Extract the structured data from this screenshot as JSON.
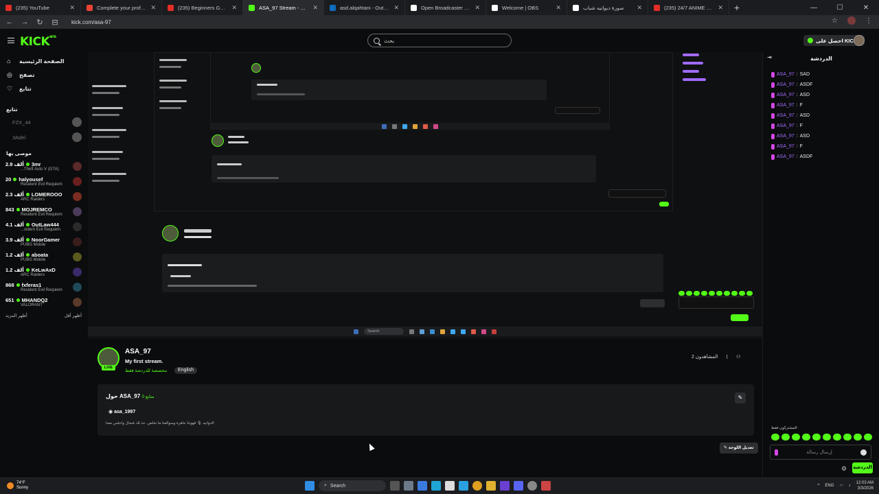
{
  "browser": {
    "tabs": [
      {
        "label": "(235) YouTube",
        "color": "#e52d27",
        "active": false
      },
      {
        "label": "Complete your profile - dr.ahm",
        "color": "#ea4335",
        "active": false
      },
      {
        "label": "(235) Beginners Guide to Kick S",
        "color": "#e52d27",
        "active": false
      },
      {
        "label": "ASA_97 Stream - Watch Live on",
        "color": "#53fc18",
        "active": true
      },
      {
        "label": "asd.alqahtani - Outlook - البريد",
        "color": "#0f6cbd",
        "active": false
      },
      {
        "label": "Open Broadcaster Software | O",
        "color": "#ffffff",
        "active": false
      },
      {
        "label": "Welcome | OBS",
        "color": "#ffffff",
        "active": false
      },
      {
        "label": "صورة ديوانيه شباب",
        "color": "#ffffff",
        "active": false
      },
      {
        "label": "(235) 24/7 ANIME LOFI & CHIL",
        "color": "#e52d27",
        "active": false
      }
    ],
    "url": "kick.com/asa-97"
  },
  "header": {
    "logo": "KICK",
    "logo_sup": "BETA",
    "search_placeholder": "بحث",
    "get_kicks": "احصل على KICKs"
  },
  "sidebar": {
    "nav": [
      {
        "label": "الصفحة الرئيسية",
        "icon": "home-icon"
      },
      {
        "label": "تصفح",
        "icon": "compass-icon"
      },
      {
        "label": "تتابع",
        "icon": "heart-icon"
      }
    ],
    "following_title": "تتابع",
    "following": [
      {
        "name": "FZX_44"
      },
      {
        "name": "3Adel"
      }
    ],
    "recommended_title": "موصى بها",
    "recommended": [
      {
        "viewers": "2.8 ألف",
        "name": "3mr",
        "category": "...Theft Auto V (GTA)",
        "avatar": "#5b2a2a"
      },
      {
        "viewers": "20",
        "name": "halyousef",
        "category": "Resident Evil Requiem",
        "avatar": "#6a1f1f"
      },
      {
        "viewers": "2.3 ألف",
        "name": "LOMEROOO",
        "category": "ARC Raiders",
        "avatar": "#7a2d20"
      },
      {
        "viewers": "843",
        "name": "MOJREMCO",
        "category": "Resident Evil Requiem",
        "avatar": "#4b3b5a"
      },
      {
        "viewers": "4.1 ألف",
        "name": "OutLaw444",
        "category": "...sident Evil Requiem",
        "avatar": "#2a2a2a"
      },
      {
        "viewers": "3.9 ألف",
        "name": "NoorGamer",
        "category": "PUBG Mobile",
        "avatar": "#3a1c1c"
      },
      {
        "viewers": "1.2 ألف",
        "name": "aboata",
        "category": "PUBG Mobile",
        "avatar": "#5a5a1f"
      },
      {
        "viewers": "1.2 ألف",
        "name": "KeLwAxD",
        "category": "ARC Raiders",
        "avatar": "#3b2a6a"
      },
      {
        "viewers": "868",
        "name": "fxferas1",
        "category": "Resident Evil Requiem",
        "avatar": "#1f4a5a"
      },
      {
        "viewers": "651",
        "name": "MHANDQ2",
        "category": "VALORANT",
        "avatar": "#5a3a2a"
      }
    ],
    "show_more": "أظهر المزيد",
    "show_less": "أظهر أقل"
  },
  "stream": {
    "name": "ASA_97",
    "title": "My first stream.",
    "category": "مخصصة للدردشة فقط",
    "tag": "English",
    "live_badge": "LIVE",
    "viewers": "المشاهدون 2",
    "about_title": "حول ASA_97",
    "followers": "0 متابع",
    "discord": "asa_1997",
    "bio": "الدوانيه 🎙 قهوتنا جاهزة وسوالفنا ما تخلص. خذ لك فنجال واجلس معنا",
    "edit_button": "تعديل اللوحة",
    "video_taskbar_search": "Search"
  },
  "chat": {
    "title": "الدردشة",
    "messages": [
      {
        "user": "ASA_97",
        "text": "SAD"
      },
      {
        "user": "ASA_97",
        "text": "ASDF"
      },
      {
        "user": "ASA_97",
        "text": "ASD"
      },
      {
        "user": "ASA_97",
        "text": "F"
      },
      {
        "user": "ASA_97",
        "text": "ASD"
      },
      {
        "user": "ASA_97",
        "text": "F"
      },
      {
        "user": "ASA_97",
        "text": "ASD"
      },
      {
        "user": "ASA_97",
        "text": "F"
      },
      {
        "user": "ASA_97",
        "text": "ASDF"
      }
    ],
    "emotes_label": "المشتركون فقط",
    "input_placeholder": "إرسال رسالة",
    "send_button": "الدردشة"
  },
  "taskbar": {
    "temp": "74°F",
    "weather": "Sunny",
    "search": "Search",
    "lang": "ENG",
    "time": "12:03 AM",
    "date": "3/3/2026"
  }
}
